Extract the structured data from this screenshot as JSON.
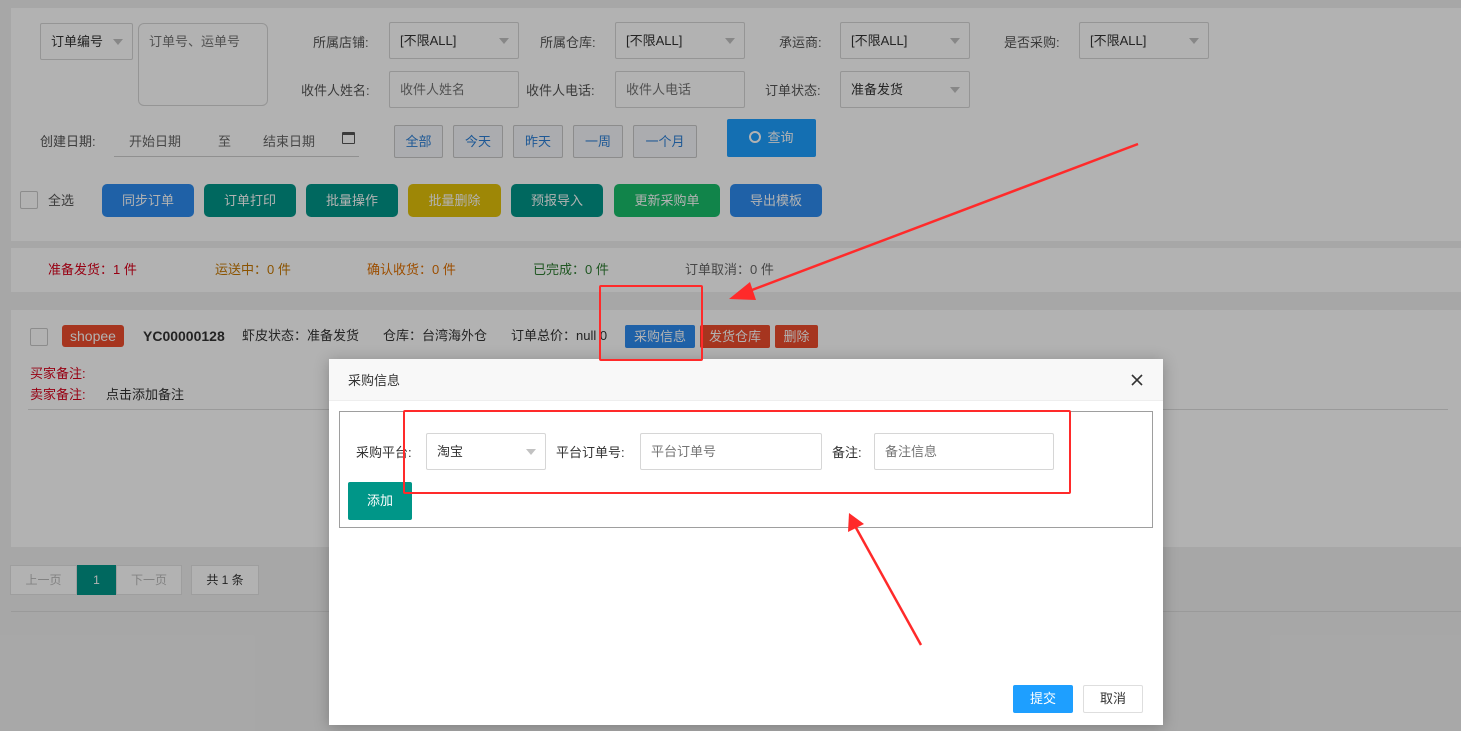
{
  "filters": {
    "order_type_select": "订单编号",
    "order_no_placeholder": "订单号、运单号",
    "shop_label": "所属店铺:",
    "shop_value": "[不限ALL]",
    "warehouse_label": "所属仓库:",
    "warehouse_value": "[不限ALL]",
    "carrier_label": "承运商:",
    "carrier_value": "[不限ALL]",
    "purchase_label": "是否采购:",
    "purchase_value": "[不限ALL]",
    "receiver_name_label": "收件人姓名:",
    "receiver_name_placeholder": "收件人姓名",
    "receiver_phone_label": "收件人电话:",
    "receiver_phone_placeholder": "收件人电话",
    "status_label": "订单状态:",
    "status_value": "准备发货",
    "date_label": "创建日期:",
    "start_date_placeholder": "开始日期",
    "date_separator": "至",
    "end_date_placeholder": "结束日期",
    "quick_ranges": [
      "全部",
      "今天",
      "昨天",
      "一周",
      "一个月"
    ],
    "search_button": "查询"
  },
  "actions": {
    "select_all": "全选",
    "buttons": [
      {
        "label": "同步订单",
        "color": "#2d8cf0"
      },
      {
        "label": "订单打印",
        "color": "#009688"
      },
      {
        "label": "批量操作",
        "color": "#009688"
      },
      {
        "label": "批量删除",
        "color": "#e2c20a"
      },
      {
        "label": "预报导入",
        "color": "#009688"
      },
      {
        "label": "更新采购单",
        "color": "#19be6b"
      },
      {
        "label": "导出模板",
        "color": "#2d8cf0"
      }
    ]
  },
  "stats": [
    {
      "label": "准备发货：1 件",
      "color": "#d9001b"
    },
    {
      "label": "运送中：0 件",
      "color": "#c77800"
    },
    {
      "label": "确认收货：0 件",
      "color": "#e07000"
    },
    {
      "label": "已完成：0 件",
      "color": "#2e7d32"
    },
    {
      "label": "订单取消：0 件",
      "color": "#666666"
    }
  ],
  "order": {
    "platform_badge": "shopee",
    "order_id": "YC00000128",
    "shopee_status": "虾皮状态：准备发货",
    "warehouse": "仓库：台湾海外仓",
    "total_price": "订单总价：null 0",
    "purchase_info_button": "采购信息",
    "ship_warehouse_button": "发货仓库",
    "delete_button": "删除",
    "buyer_note_label": "买家备注:",
    "seller_note_label": "卖家备注:",
    "seller_note_value": "点击添加备注"
  },
  "pagination": {
    "prev": "上一页",
    "current": "1",
    "next": "下一页",
    "total": "共 1 条"
  },
  "dialog": {
    "title": "采购信息",
    "platform_label": "采购平台:",
    "platform_value": "淘宝",
    "platform_order_label": "平台订单号:",
    "platform_order_placeholder": "平台订单号",
    "remark_label": "备注:",
    "remark_placeholder": "备注信息",
    "add_button": "添加",
    "submit_button": "提交",
    "cancel_button": "取消"
  },
  "colors": {
    "primary": "#1e9fff",
    "teal": "#009688",
    "annotation_red": "#ff2a2a"
  }
}
